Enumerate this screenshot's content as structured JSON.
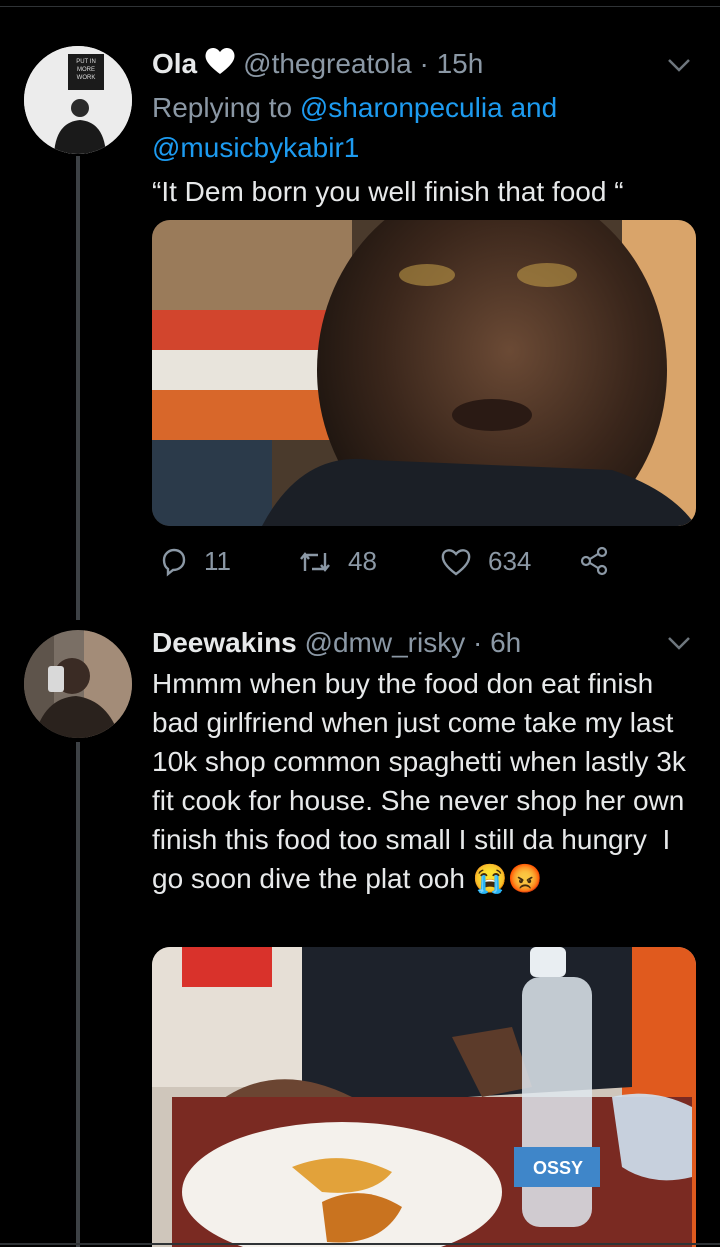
{
  "tweet1": {
    "name": "Ola",
    "handle": "@thegreatola",
    "separator": "·",
    "time": "15h",
    "replying_label": "Replying to",
    "mention1": "@sharonpeculia",
    "and_word": "and",
    "mention2": "@musicbykabir1",
    "text": "“It Dem born you well finish that food “",
    "avatar_sign": [
      "PUT IN",
      "MORE",
      "WORK"
    ],
    "counts": {
      "replies": "11",
      "retweets": "48",
      "likes": "634"
    }
  },
  "tweet2": {
    "name": "Deewakins",
    "handle": "@dmw_risky",
    "separator": "·",
    "time": "6h",
    "text": "Hmmm when buy the food don eat finish bad girlfriend when just come take my last 10k shop common spaghetti when lastly 3k   fit cook for house. She never shop her own finish this food too small I still da hungry  I go soon dive the plat ooh ",
    "emojis": "😭😡",
    "bottle_label": "OSSY"
  },
  "colors": {
    "background": "#000000",
    "link": "#1d9bf0",
    "muted": "#8b98a5",
    "text": "#e7e9ea"
  },
  "icons": [
    "reply-icon",
    "retweet-icon",
    "like-icon",
    "share-icon",
    "chevron-down-icon",
    "heart-badge-icon"
  ]
}
